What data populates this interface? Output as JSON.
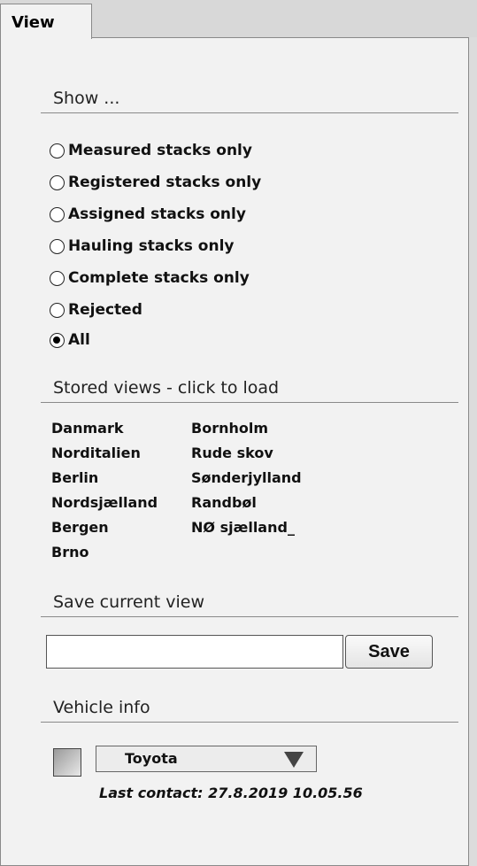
{
  "tab": {
    "label": "View"
  },
  "show_section": {
    "header": "Show ...",
    "options": [
      {
        "label": "Measured stacks only",
        "checked": false
      },
      {
        "label": "Registered stacks only",
        "checked": false
      },
      {
        "label": "Assigned stacks only",
        "checked": false
      },
      {
        "label": "Hauling stacks only",
        "checked": false
      },
      {
        "label": "Complete stacks only",
        "checked": false
      },
      {
        "label": "Rejected",
        "checked": false
      },
      {
        "label": "All",
        "checked": true
      }
    ]
  },
  "stored_views": {
    "header": "Stored views - click to load",
    "col1": [
      "Danmark",
      "Norditalien",
      "Berlin",
      "Nordsjælland",
      "Bergen",
      "Brno"
    ],
    "col2": [
      "Bornholm",
      "Rude skov",
      "Sønderjylland",
      "Randbøl",
      "NØ sjælland_"
    ]
  },
  "save_view": {
    "header": "Save current view",
    "input_value": "",
    "button_label": "Save"
  },
  "vehicle_info": {
    "header": "Vehicle info",
    "selected_vehicle": "Toyota",
    "last_contact": "Last contact: 27.8.2019 10.05.56"
  }
}
